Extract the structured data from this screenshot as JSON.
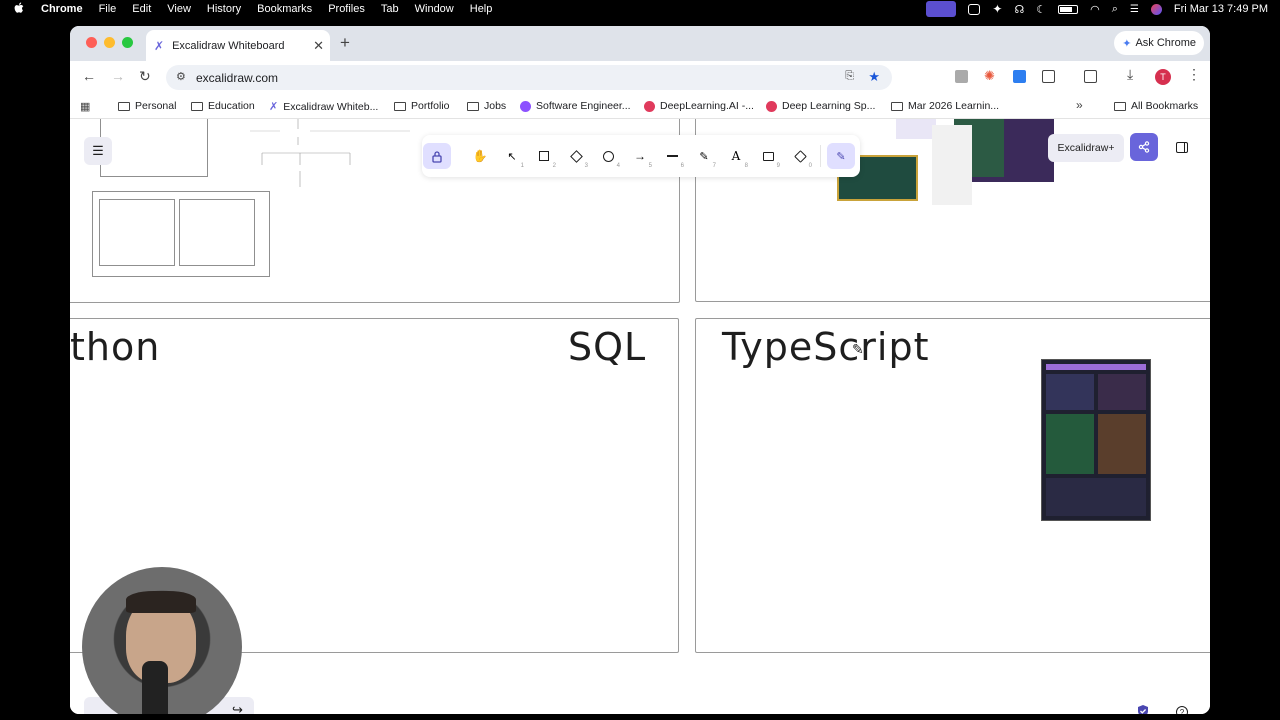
{
  "menubar": {
    "app": "Chrome",
    "items": [
      "File",
      "Edit",
      "View",
      "History",
      "Bookmarks",
      "Profiles",
      "Tab",
      "Window",
      "Help"
    ],
    "datetime": "Fri Mar 13  7:49 PM"
  },
  "tab": {
    "title": "Excalidraw Whiteboard"
  },
  "ask_chrome": "Ask Chrome",
  "omnibox": {
    "url": "excalidraw.com"
  },
  "bookmarks": [
    "Personal",
    "Education",
    "Excalidraw Whiteb...",
    "Portfolio",
    "Jobs",
    "Software Engineer...",
    "DeepLearning.AI -...",
    "Deep Learning Sp...",
    "Mar 2026 Learnin...",
    "All Bookmarks"
  ],
  "profile_initial": "T",
  "canvas": {
    "labels": {
      "python": "thon",
      "sql": "SQL",
      "typescript": "TypeScript"
    },
    "excalidraw_plus": "Excalidraw+"
  },
  "toolbar_tools": [
    {
      "name": "lock-icon",
      "key": ""
    },
    {
      "name": "hand-icon",
      "key": ""
    },
    {
      "name": "pointer-icon",
      "key": "1"
    },
    {
      "name": "rectangle-icon",
      "key": "2"
    },
    {
      "name": "diamond-icon",
      "key": "3"
    },
    {
      "name": "ellipse-icon",
      "key": "4"
    },
    {
      "name": "arrow-icon",
      "key": "5"
    },
    {
      "name": "line-icon",
      "key": "6"
    },
    {
      "name": "pencil-icon",
      "key": "7"
    },
    {
      "name": "text-icon",
      "key": "8"
    },
    {
      "name": "image-icon",
      "key": "9"
    },
    {
      "name": "eraser-icon",
      "key": "0"
    },
    {
      "name": "laser-icon",
      "key": ""
    }
  ],
  "colors": {
    "accent": "#6965db",
    "tab_bar": "#dfe3ea",
    "toolbar_active": "#e0dfff"
  }
}
